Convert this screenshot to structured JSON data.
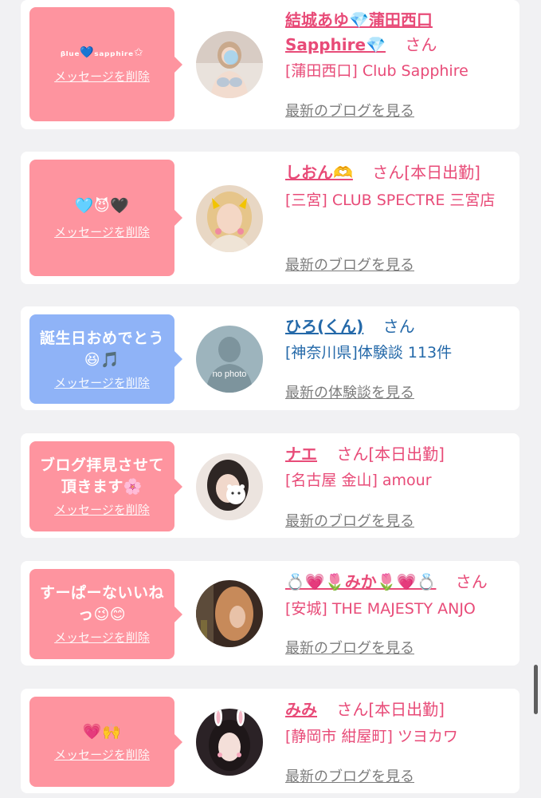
{
  "delete_label": "メッセージを削除",
  "san_label": "さん",
  "messages": [
    {
      "bubble_text": "ᵦₗᵤₑ💙ₛₐₚₚₕᵢᵣₑ✩",
      "bubble_color": "#fe949f",
      "name": "結城あゆ💎蒲田西口Sapphire💎",
      "name_color": "#e84b78",
      "status": "",
      "shop": "[蒲田西口] Club Sapphire",
      "link": "最新のブログを見る",
      "avatar_icon": "girl-photo"
    },
    {
      "bubble_text": "🩵😈🖤",
      "bubble_color": "#fe949f",
      "name": "しおん🫶",
      "name_color": "#e84b78",
      "status": "[本日出勤]",
      "shop": "[三宮] CLUB SPECTRE 三宮店",
      "link": "最新のブログを見る",
      "avatar_icon": "girl-photo"
    },
    {
      "bubble_text": "誕生日おめでとう😆🎵",
      "bubble_color": "#8fb3f7",
      "name": "ひろ(くん)",
      "name_color": "#2469a9",
      "status": "",
      "shop": "[神奈川県]体験談 113件",
      "link": "最新の体験談を見る",
      "avatar_icon": "no-photo-silhouette",
      "avatar_text": "no photo"
    },
    {
      "bubble_text": "ブログ拝見させて頂きます🌸",
      "bubble_color": "#fe949f",
      "name": "ナエ",
      "name_color": "#e84b78",
      "status": "[本日出勤]",
      "shop": "[名古屋 金山] amour",
      "link": "最新のブログを見る",
      "avatar_icon": "girl-photo"
    },
    {
      "bubble_text": "すーぱーないいねっ😉😊",
      "bubble_color": "#fe949f",
      "name": "💍💗🌷みか🌷💗💍",
      "name_color": "#e84b78",
      "status": "",
      "shop": "[安城] THE MAJESTY ANJO",
      "link": "最新のブログを見る",
      "avatar_icon": "girl-photo"
    },
    {
      "bubble_text": "💗🙌",
      "bubble_color": "#fe949f",
      "name": "みみ",
      "name_color": "#e84b78",
      "status": "[本日出勤]",
      "shop": "[静岡市 紺屋町] ツヨカワ",
      "link": "最新のブログを見る",
      "avatar_icon": "girl-photo"
    }
  ]
}
